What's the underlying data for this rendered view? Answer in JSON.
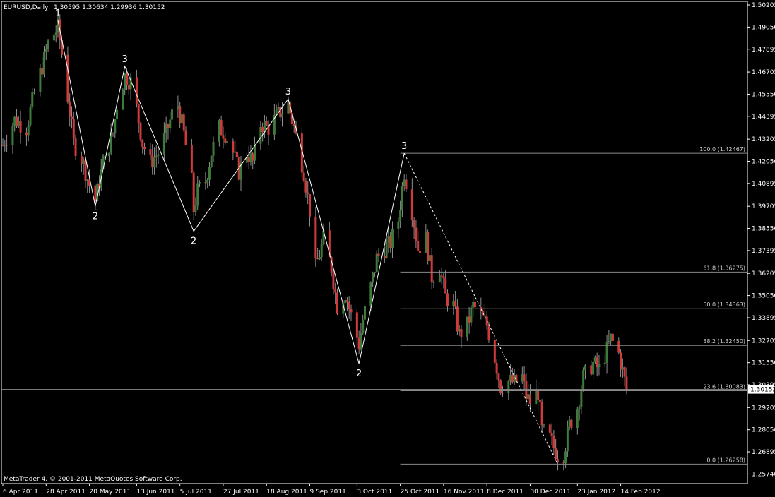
{
  "header": {
    "symbol": "EURUSD,Daily",
    "ohlc": "1.30595 1.30634 1.29936 1.30152"
  },
  "footer": {
    "copyright": "MetaTrader 4, © 2001-2011 MetaQuotes Software Corp."
  },
  "colors": {
    "background": "#000000",
    "frame": "#ffffff",
    "bull_candle": "#3e7a3a",
    "bear_candle": "#cf3b3b",
    "wick": "#8f8f8f",
    "wave_line": "#ffffff",
    "fib_line": "#8a8a8a",
    "price_line": "#8a8a8a",
    "current_price_bg": "#ffffff",
    "current_price_text": "#000000"
  },
  "chart_data": {
    "type": "candlestick",
    "ylim": [
      1.2524,
      1.5039
    ],
    "price_ticks": [
      1.50205,
      1.4905,
      1.47895,
      1.46705,
      1.4555,
      1.44395,
      1.43205,
      1.4205,
      1.40895,
      1.39705,
      1.3855,
      1.37395,
      1.36205,
      1.3505,
      1.33895,
      1.32705,
      1.3155,
      1.30395,
      1.29205,
      1.2805,
      1.26895,
      1.2574
    ],
    "price_tick_labels": [
      "1.50205",
      "1.49050",
      "1.47895",
      "1.46705",
      "1.45550",
      "1.44395",
      "1.43205",
      "1.42050",
      "1.40895",
      "1.39705",
      "1.38550",
      "1.37395",
      "1.36205",
      "1.35050",
      "1.33895",
      "1.32705",
      "1.31550",
      "1.30395",
      "1.29205",
      "1.28050",
      "1.26895",
      "1.25740"
    ],
    "current_price": 1.30152,
    "current_price_label": "1.30152",
    "x_range": [
      "2011-04-06",
      "2012-02-26"
    ],
    "date_ticks": [
      {
        "date": "2011-04-06",
        "label": "6 Apr 2011"
      },
      {
        "date": "2011-04-28",
        "label": "28 Apr 2011"
      },
      {
        "date": "2011-05-20",
        "label": "20 May 2011"
      },
      {
        "date": "2011-06-13",
        "label": "13 Jun 2011"
      },
      {
        "date": "2011-07-05",
        "label": "5 Jul 2011"
      },
      {
        "date": "2011-07-27",
        "label": "27 Jul 2011"
      },
      {
        "date": "2011-08-18",
        "label": "18 Aug 2011"
      },
      {
        "date": "2011-09-09",
        "label": "9 Sep 2011"
      },
      {
        "date": "2011-10-03",
        "label": "3 Oct 2011"
      },
      {
        "date": "2011-10-25",
        "label": "25 Oct 2011"
      },
      {
        "date": "2011-11-16",
        "label": "16 Nov 2011"
      },
      {
        "date": "2011-12-08",
        "label": "8 Dec 2011"
      },
      {
        "date": "2011-12-30",
        "label": "30 Dec 2011"
      },
      {
        "date": "2012-01-23",
        "label": "23 Jan 2012"
      },
      {
        "date": "2012-02-14",
        "label": "14 Feb 2012"
      }
    ],
    "price_path": [
      [
        "2011-04-06",
        1.429
      ],
      [
        "2011-04-12",
        1.442
      ],
      [
        "2011-04-18",
        1.438
      ],
      [
        "2011-04-22",
        1.456
      ],
      [
        "2011-04-26",
        1.47
      ],
      [
        "2011-04-29",
        1.482
      ],
      [
        "2011-05-04",
        1.49
      ],
      [
        "2011-05-05",
        1.484
      ],
      [
        "2011-05-09",
        1.454
      ],
      [
        "2011-05-12",
        1.43
      ],
      [
        "2011-05-16",
        1.422
      ],
      [
        "2011-05-20",
        1.408
      ],
      [
        "2011-05-23",
        1.4
      ],
      [
        "2011-05-27",
        1.42
      ],
      [
        "2011-06-01",
        1.435
      ],
      [
        "2011-06-03",
        1.45
      ],
      [
        "2011-06-07",
        1.465
      ],
      [
        "2011-06-10",
        1.462
      ],
      [
        "2011-06-13",
        1.448
      ],
      [
        "2011-06-16",
        1.43
      ],
      [
        "2011-06-20",
        1.42
      ],
      [
        "2011-06-24",
        1.425
      ],
      [
        "2011-06-28",
        1.435
      ],
      [
        "2011-07-01",
        1.445
      ],
      [
        "2011-07-04",
        1.45
      ],
      [
        "2011-07-07",
        1.435
      ],
      [
        "2011-07-11",
        1.41
      ],
      [
        "2011-07-12",
        1.395
      ],
      [
        "2011-07-14",
        1.405
      ],
      [
        "2011-07-18",
        1.41
      ],
      [
        "2011-07-21",
        1.425
      ],
      [
        "2011-07-25",
        1.438
      ],
      [
        "2011-07-28",
        1.435
      ],
      [
        "2011-08-01",
        1.425
      ],
      [
        "2011-08-04",
        1.415
      ],
      [
        "2011-08-08",
        1.425
      ],
      [
        "2011-08-11",
        1.42
      ],
      [
        "2011-08-15",
        1.44
      ],
      [
        "2011-08-19",
        1.438
      ],
      [
        "2011-08-24",
        1.445
      ],
      [
        "2011-08-29",
        1.45
      ],
      [
        "2011-09-01",
        1.438
      ],
      [
        "2011-09-06",
        1.415
      ],
      [
        "2011-09-09",
        1.395
      ],
      [
        "2011-09-12",
        1.365
      ],
      [
        "2011-09-16",
        1.38
      ],
      [
        "2011-09-20",
        1.365
      ],
      [
        "2011-09-23",
        1.345
      ],
      [
        "2011-09-27",
        1.352
      ],
      [
        "2011-09-30",
        1.34
      ],
      [
        "2011-10-04",
        1.325
      ],
      [
        "2011-10-06",
        1.338
      ],
      [
        "2011-10-10",
        1.355
      ],
      [
        "2011-10-13",
        1.37
      ],
      [
        "2011-10-17",
        1.375
      ],
      [
        "2011-10-20",
        1.378
      ],
      [
        "2011-10-24",
        1.39
      ],
      [
        "2011-10-27",
        1.415
      ],
      [
        "2011-10-31",
        1.395
      ],
      [
        "2011-11-03",
        1.375
      ],
      [
        "2011-11-07",
        1.38
      ],
      [
        "2011-11-10",
        1.36
      ],
      [
        "2011-11-14",
        1.365
      ],
      [
        "2011-11-17",
        1.35
      ],
      [
        "2011-11-21",
        1.345
      ],
      [
        "2011-11-24",
        1.33
      ],
      [
        "2011-11-28",
        1.335
      ],
      [
        "2011-12-01",
        1.345
      ],
      [
        "2011-12-05",
        1.34
      ],
      [
        "2011-12-08",
        1.335
      ],
      [
        "2011-12-12",
        1.318
      ],
      [
        "2011-12-15",
        1.303
      ],
      [
        "2011-12-19",
        1.306
      ],
      [
        "2011-12-22",
        1.305
      ],
      [
        "2011-12-26",
        1.308
      ],
      [
        "2011-12-28",
        1.298
      ],
      [
        "2011-12-30",
        1.295
      ],
      [
        "2012-01-03",
        1.3
      ],
      [
        "2012-01-05",
        1.28
      ],
      [
        "2012-01-09",
        1.276
      ],
      [
        "2012-01-13",
        1.267
      ],
      [
        "2012-01-16",
        1.268
      ],
      [
        "2012-01-19",
        1.283
      ],
      [
        "2012-01-23",
        1.292
      ],
      [
        "2012-01-26",
        1.308
      ],
      [
        "2012-01-31",
        1.315
      ],
      [
        "2012-02-03",
        1.312
      ],
      [
        "2012-02-07",
        1.322
      ],
      [
        "2012-02-09",
        1.328
      ],
      [
        "2012-02-13",
        1.32
      ],
      [
        "2012-02-15",
        1.311
      ],
      [
        "2012-02-17",
        1.3015
      ]
    ],
    "wave_path": [
      {
        "date": "2011-05-04",
        "price": 1.494,
        "label": "1"
      },
      {
        "date": "2011-05-23",
        "price": 1.397,
        "label": "2"
      },
      {
        "date": "2011-06-07",
        "price": 1.47,
        "label": "3"
      },
      {
        "date": "2011-07-12",
        "price": 1.384,
        "label": "2"
      },
      {
        "date": "2011-08-29",
        "price": 1.453,
        "label": "3"
      },
      {
        "date": "2011-10-04",
        "price": 1.315,
        "label": "2"
      },
      {
        "date": "2011-10-27",
        "price": 1.4247,
        "label": "3"
      }
    ],
    "wave_labels": [
      "1",
      "2",
      "3",
      "2",
      "3",
      "2",
      "3"
    ],
    "dotted_line": [
      {
        "date": "2011-10-27",
        "price": 1.4247
      },
      {
        "date": "2012-01-13",
        "price": 1.2626
      }
    ],
    "fibonacci": {
      "start_date": "2011-10-25",
      "levels": [
        {
          "price": 1.42467,
          "label": "100.0 (1.42467)"
        },
        {
          "price": 1.36275,
          "label": "61.8 (1.36275)"
        },
        {
          "price": 1.34363,
          "label": "50.0 (1.34363)"
        },
        {
          "price": 1.3245,
          "label": "38.2 (1.32450)"
        },
        {
          "price": 1.30083,
          "label": "23.6 (1.30083)"
        },
        {
          "price": 1.26258,
          "label": "0.0 (1.26258)"
        }
      ]
    }
  }
}
